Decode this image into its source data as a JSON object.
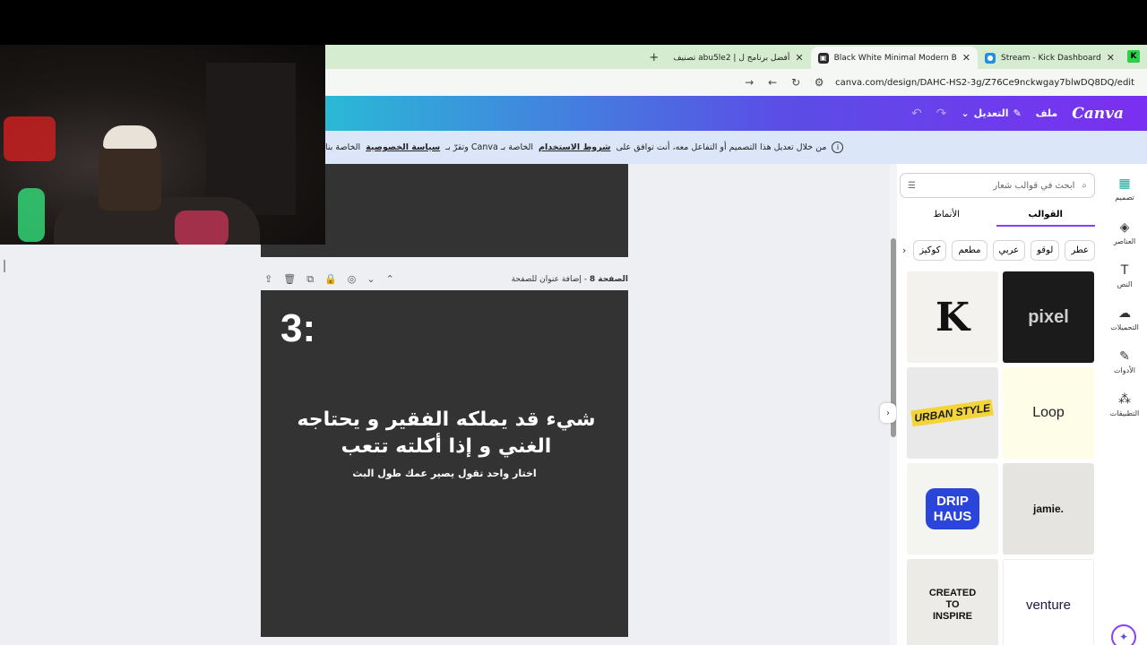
{
  "browser": {
    "tabs": [
      {
        "title": "Stream - Kick Dashboard",
        "favicon": "kick-icon",
        "active": false
      },
      {
        "title": "Black White Minimal Modern B",
        "favicon": "canva-icon",
        "active": true
      },
      {
        "title": "تصنيف abu5le2 | أفضل برنامج ل",
        "favicon": "site-icon",
        "active": false
      }
    ],
    "url": "canva.com/design/DAHC-HS2-3g/Z76Ce9nckwgay7blwDQ8DQ/edit"
  },
  "header": {
    "logo": "Canva",
    "file_label": "ملف",
    "edit_label": "التعديل"
  },
  "notice": {
    "text_start": "من خلال تعديل هذا التصميم أو التفاعل معه، أنت توافق على",
    "terms": "شروط الاستخدام",
    "text_mid": "الخاصة بـ Canva وتقرّ بـ",
    "privacy": "سياسة الخصوصية",
    "text_end": "الخاصة بنا"
  },
  "page": {
    "label": "الصفحة 8",
    "title_placeholder": "- إضافة عنوان للصفحة",
    "number": "3:",
    "question": "شيء قد يملكه الفقير و يحتاجه الغني و إذا أكلته تتعب",
    "subtitle": "اختار واحد تقول يصير عمك طول البث"
  },
  "panel": {
    "search_placeholder": "ابحث في قوالب شعار",
    "tabs": [
      "القوالب",
      "الأنماط"
    ],
    "chips": [
      "عطر",
      "لوقو",
      "عربي",
      "مطعم",
      "كوكيز"
    ],
    "templates": [
      {
        "label": "K"
      },
      {
        "label": "pixel"
      },
      {
        "label": "URBAN STYLE"
      },
      {
        "label": "Loop"
      },
      {
        "label": "DRIP HAUS"
      },
      {
        "label": "jamie."
      },
      {
        "label": "CREATED TO INSPIRE"
      },
      {
        "label": "venture"
      }
    ]
  },
  "rail": {
    "items": [
      {
        "label": "تصميم",
        "icon": "design-icon"
      },
      {
        "label": "العناصر",
        "icon": "elements-icon"
      },
      {
        "label": "النص",
        "icon": "text-icon"
      },
      {
        "label": "التحميلات",
        "icon": "upload-icon"
      },
      {
        "label": "الأدوات",
        "icon": "tools-icon"
      },
      {
        "label": "التطبيقات",
        "icon": "apps-icon"
      }
    ]
  },
  "colors": {
    "accent": "#8b3dff",
    "canvas_bg": "#333333",
    "tabbar_bg": "#d6ecd0",
    "notice_bg": "#dbe6f8"
  }
}
